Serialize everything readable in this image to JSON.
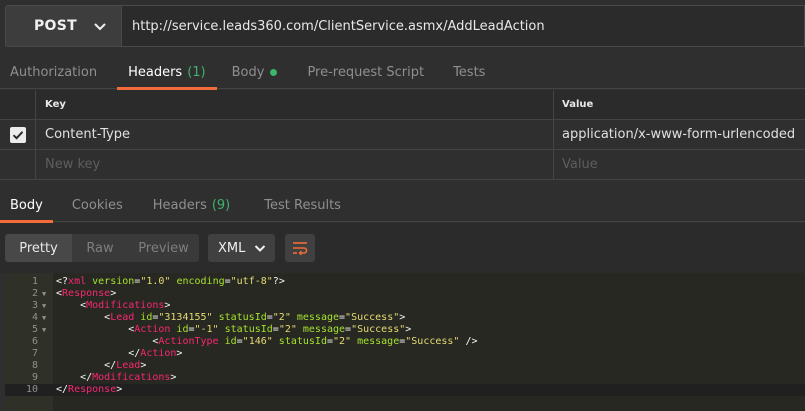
{
  "request": {
    "method": "POST",
    "url": "http://service.leads360.com/ClientService.asmx/AddLeadAction"
  },
  "request_tabs": [
    {
      "label": "Authorization",
      "count": "",
      "active": false,
      "dot": false
    },
    {
      "label": "Headers",
      "count": "(1)",
      "active": true,
      "dot": false
    },
    {
      "label": "Body",
      "count": "",
      "active": false,
      "dot": true
    },
    {
      "label": "Pre-request Script",
      "count": "",
      "active": false,
      "dot": false
    },
    {
      "label": "Tests",
      "count": "",
      "active": false,
      "dot": false
    }
  ],
  "headers_table": {
    "col_key": "Key",
    "col_value": "Value",
    "rows": [
      {
        "checked": true,
        "key": "Content-Type",
        "value": "application/x-www-form-urlencoded"
      }
    ],
    "placeholder_key": "New key",
    "placeholder_value": "Value"
  },
  "response_tabs": [
    {
      "label": "Body",
      "count": "",
      "active": true
    },
    {
      "label": "Cookies",
      "count": "",
      "active": false
    },
    {
      "label": "Headers",
      "count": "(9)",
      "active": false
    },
    {
      "label": "Test Results",
      "count": "",
      "active": false
    }
  ],
  "view_modes": [
    "Pretty",
    "Raw",
    "Preview"
  ],
  "active_view": "Pretty",
  "format": "XML",
  "icons": {
    "method_dropdown": "chevron-down-icon",
    "format_dropdown": "chevron-down-icon",
    "wrap": "wrap-lines-icon",
    "check": "check-icon",
    "fold": "fold-arrow-icon"
  },
  "colors": {
    "accent": "#f26b3a",
    "count": "#3db36b",
    "tag": "#f92672",
    "attr": "#a6e22e",
    "string": "#e6db74"
  },
  "code_lines": [
    {
      "n": "1",
      "fold": false,
      "tokens": [
        [
          "p",
          "<?"
        ],
        [
          "tag",
          "xml"
        ],
        [
          "attr",
          " version"
        ],
        [
          "p",
          "="
        ],
        [
          "str",
          "\"1.0\""
        ],
        [
          "attr",
          " encoding"
        ],
        [
          "p",
          "="
        ],
        [
          "str",
          "\"utf-8\""
        ],
        [
          "p",
          "?>"
        ]
      ]
    },
    {
      "n": "2",
      "fold": true,
      "tokens": [
        [
          "p",
          "<"
        ],
        [
          "tag",
          "Response"
        ],
        [
          "p",
          ">"
        ]
      ]
    },
    {
      "n": "3",
      "fold": true,
      "tokens": [
        [
          "p",
          "    <"
        ],
        [
          "tag",
          "Modifications"
        ],
        [
          "p",
          ">"
        ]
      ]
    },
    {
      "n": "4",
      "fold": true,
      "tokens": [
        [
          "p",
          "        <"
        ],
        [
          "tag",
          "Lead"
        ],
        [
          "attr",
          " id"
        ],
        [
          "p",
          "="
        ],
        [
          "str",
          "\"3134155\""
        ],
        [
          "attr",
          " statusId"
        ],
        [
          "p",
          "="
        ],
        [
          "str",
          "\"2\""
        ],
        [
          "attr",
          " message"
        ],
        [
          "p",
          "="
        ],
        [
          "str",
          "\"Success\""
        ],
        [
          "p",
          ">"
        ]
      ]
    },
    {
      "n": "5",
      "fold": true,
      "tokens": [
        [
          "p",
          "            <"
        ],
        [
          "tag",
          "Action"
        ],
        [
          "attr",
          " id"
        ],
        [
          "p",
          "="
        ],
        [
          "str",
          "\"-1\""
        ],
        [
          "attr",
          " statusId"
        ],
        [
          "p",
          "="
        ],
        [
          "str",
          "\"2\""
        ],
        [
          "attr",
          " message"
        ],
        [
          "p",
          "="
        ],
        [
          "str",
          "\"Success\""
        ],
        [
          "p",
          ">"
        ]
      ]
    },
    {
      "n": "6",
      "fold": false,
      "tokens": [
        [
          "p",
          "                <"
        ],
        [
          "tag",
          "ActionType"
        ],
        [
          "attr",
          " id"
        ],
        [
          "p",
          "="
        ],
        [
          "str",
          "\"146\""
        ],
        [
          "attr",
          " statusId"
        ],
        [
          "p",
          "="
        ],
        [
          "str",
          "\"2\""
        ],
        [
          "attr",
          " message"
        ],
        [
          "p",
          "="
        ],
        [
          "str",
          "\"Success\""
        ],
        [
          "p",
          " />"
        ]
      ]
    },
    {
      "n": "7",
      "fold": false,
      "tokens": [
        [
          "p",
          "            </"
        ],
        [
          "tag",
          "Action"
        ],
        [
          "p",
          ">"
        ]
      ]
    },
    {
      "n": "8",
      "fold": false,
      "tokens": [
        [
          "p",
          "        </"
        ],
        [
          "tag",
          "Lead"
        ],
        [
          "p",
          ">"
        ]
      ]
    },
    {
      "n": "9",
      "fold": false,
      "tokens": [
        [
          "p",
          "    </"
        ],
        [
          "tag",
          "Modifications"
        ],
        [
          "p",
          ">"
        ]
      ]
    },
    {
      "n": "10",
      "fold": false,
      "tokens": [
        [
          "p",
          "</"
        ],
        [
          "tag",
          "Response"
        ],
        [
          "p",
          ">"
        ]
      ]
    }
  ]
}
